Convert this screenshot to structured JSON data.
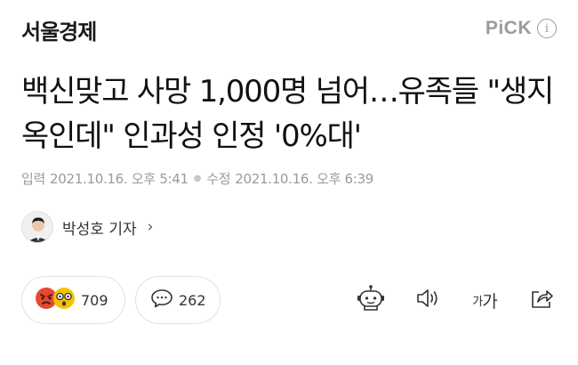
{
  "header": {
    "press_name": "서울경제",
    "pick_label": "PiCK",
    "info_glyph": "i"
  },
  "article": {
    "headline": "백신맞고 사망 1,000명 넘어…유족들 \"생지옥인데\" 인과성 인정 '0%대'",
    "input_label": "입력",
    "input_date": "2021.10.16. 오후 5:41",
    "modified_label": "수정",
    "modified_date": "2021.10.16. 오후 6:39"
  },
  "reporter": {
    "name": "박성호 기자",
    "chevron": "›"
  },
  "actions": {
    "reaction_count": "709",
    "comment_count": "262",
    "font_size_label_small": "가",
    "font_size_label_large": "가"
  },
  "colors": {
    "angry": "#e8472f",
    "surprised": "#f5c400",
    "muted": "#9a9a9a"
  },
  "icons": [
    "info-icon",
    "angry-reaction-icon",
    "surprised-reaction-icon",
    "comment-icon",
    "summary-bot-icon",
    "audio-icon",
    "share-icon"
  ]
}
